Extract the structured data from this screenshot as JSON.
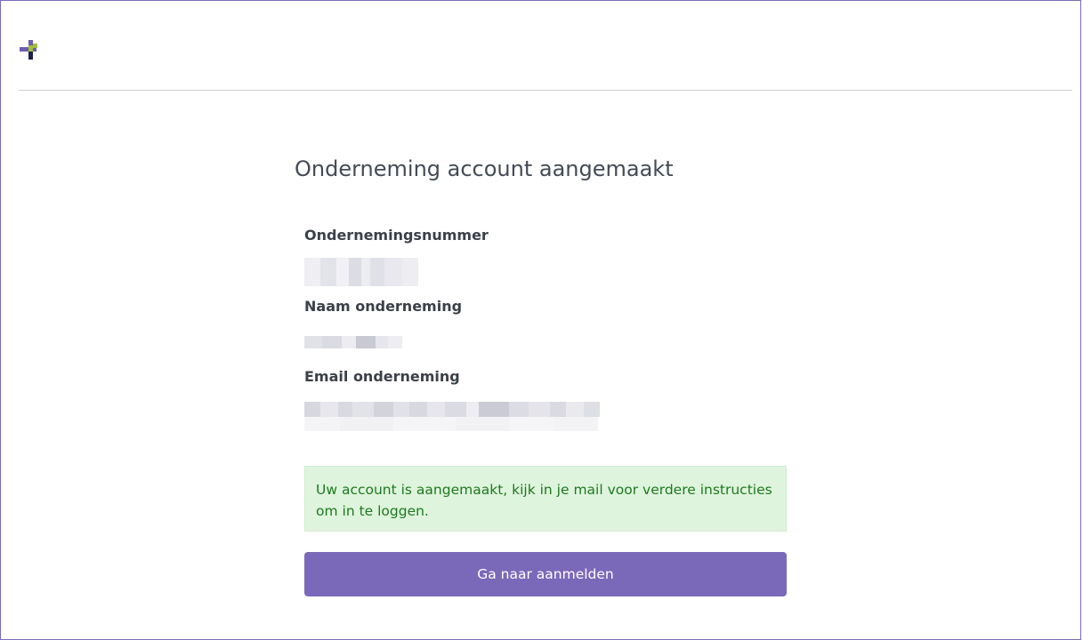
{
  "page": {
    "title": "Onderneming account aangemaakt"
  },
  "logo": {
    "icon": "pixel-plus-logo",
    "colors": {
      "purple": "#6a5fb0",
      "navy": "#1c1f4a",
      "green": "#9fbe3a"
    }
  },
  "fields": {
    "company_number_label": "Ondernemingsnummer",
    "company_name_label": "Naam onderneming",
    "company_email_label": "Email onderneming"
  },
  "alert": {
    "message": "Uw account is aangemaakt, kijk in je mail voor verdere instructies om in te loggen.",
    "color": "#1c7a1f",
    "background": "#dff4dd"
  },
  "actions": {
    "login_label": "Ga naar aanmelden",
    "color": "#7a69b9"
  }
}
